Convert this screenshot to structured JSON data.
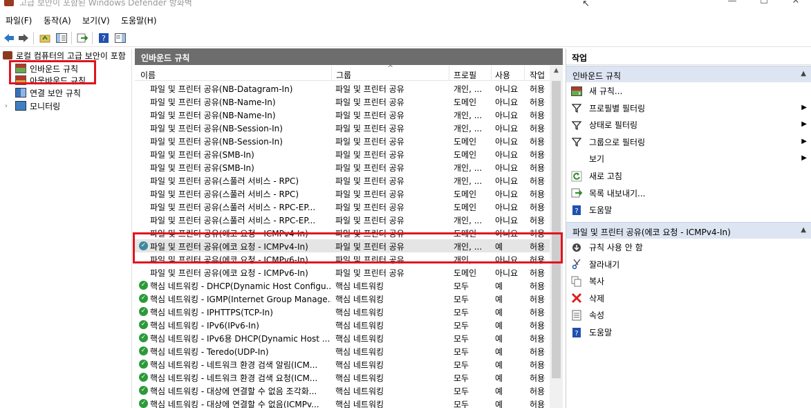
{
  "window": {
    "title": "고급 보안이 포함된 Windows Defender 방화벽",
    "min": "—",
    "max": "☐",
    "close": "✕"
  },
  "menu": [
    "파일(F)",
    "동작(A)",
    "보기(V)",
    "도움말(H)"
  ],
  "tree": {
    "root": "로컬 컴퓨터의 고급 보안이 포함",
    "items": [
      "인바운드 규칙",
      "아웃바운드 규칙",
      "연결 보안 규칙",
      "모니터링"
    ]
  },
  "center": {
    "title": "인바운드 규칙",
    "columns": [
      "이름",
      "그룹",
      "프로필",
      "사용",
      "작업"
    ],
    "rows": [
      {
        "name": "파일 및 프린터 공유(NB-Datagram-In)",
        "group": "파일 및 프린터 공유",
        "profile": "개인, ...",
        "enabled": "아니요",
        "action": "허용",
        "icon": "none"
      },
      {
        "name": "파일 및 프린터 공유(NB-Name-In)",
        "group": "파일 및 프린터 공유",
        "profile": "도메인",
        "enabled": "아니요",
        "action": "허용",
        "icon": "none"
      },
      {
        "name": "파일 및 프린터 공유(NB-Name-In)",
        "group": "파일 및 프린터 공유",
        "profile": "개인, ...",
        "enabled": "아니요",
        "action": "허용",
        "icon": "none"
      },
      {
        "name": "파일 및 프린터 공유(NB-Session-In)",
        "group": "파일 및 프린터 공유",
        "profile": "개인, ...",
        "enabled": "아니요",
        "action": "허용",
        "icon": "none"
      },
      {
        "name": "파일 및 프린터 공유(NB-Session-In)",
        "group": "파일 및 프린터 공유",
        "profile": "도메인",
        "enabled": "아니요",
        "action": "허용",
        "icon": "none"
      },
      {
        "name": "파일 및 프린터 공유(SMB-In)",
        "group": "파일 및 프린터 공유",
        "profile": "도메인",
        "enabled": "아니요",
        "action": "허용",
        "icon": "none"
      },
      {
        "name": "파일 및 프린터 공유(SMB-In)",
        "group": "파일 및 프린터 공유",
        "profile": "개인, ...",
        "enabled": "아니요",
        "action": "허용",
        "icon": "none"
      },
      {
        "name": "파일 및 프린터 공유(스풀러 서비스 - RPC)",
        "group": "파일 및 프린터 공유",
        "profile": "개인, ...",
        "enabled": "아니요",
        "action": "허용",
        "icon": "none"
      },
      {
        "name": "파일 및 프린터 공유(스풀러 서비스 - RPC)",
        "group": "파일 및 프린터 공유",
        "profile": "도메인",
        "enabled": "아니요",
        "action": "허용",
        "icon": "none"
      },
      {
        "name": "파일 및 프린터 공유(스풀러 서비스 - RPC-EP...",
        "group": "파일 및 프린터 공유",
        "profile": "도메인",
        "enabled": "아니요",
        "action": "허용",
        "icon": "none"
      },
      {
        "name": "파일 및 프린터 공유(스풀러 서비스 - RPC-EP...",
        "group": "파일 및 프린터 공유",
        "profile": "개인, ...",
        "enabled": "아니요",
        "action": "허용",
        "icon": "none"
      },
      {
        "name": "파일 및 프린터 공유(에코 요청 - ICMPv4-In)",
        "group": "파일 및 프린터 공유",
        "profile": "도메인",
        "enabled": "아니요",
        "action": "허용",
        "icon": "none"
      },
      {
        "name": "파일 및 프린터 공유(에코 요청 - ICMPv4-In)",
        "group": "파일 및 프린터 공유",
        "profile": "개인, ...",
        "enabled": "예",
        "action": "허용",
        "icon": "check-selected"
      },
      {
        "name": "파일 및 프린터 공유(에코 요청 - ICMPv6-In)",
        "group": "파일 및 프린터 공유",
        "profile": "개인, ...",
        "enabled": "아니요",
        "action": "허용",
        "icon": "none"
      },
      {
        "name": "파일 및 프린터 공유(에코 요청 - ICMPv6-In)",
        "group": "파일 및 프린터 공유",
        "profile": "도메인",
        "enabled": "아니요",
        "action": "허용",
        "icon": "none"
      },
      {
        "name": "핵심 네트워킹 - DHCP(Dynamic Host Configu...",
        "group": "핵심 네트워킹",
        "profile": "모두",
        "enabled": "예",
        "action": "허용",
        "icon": "check"
      },
      {
        "name": "핵심 네트워킹 - IGMP(Internet Group Manage...",
        "group": "핵심 네트워킹",
        "profile": "모두",
        "enabled": "예",
        "action": "허용",
        "icon": "check"
      },
      {
        "name": "핵심 네트워킹 - IPHTTPS(TCP-In)",
        "group": "핵심 네트워킹",
        "profile": "모두",
        "enabled": "예",
        "action": "허용",
        "icon": "check"
      },
      {
        "name": "핵심 네트워킹 - IPv6(IPv6-In)",
        "group": "핵심 네트워킹",
        "profile": "모두",
        "enabled": "예",
        "action": "허용",
        "icon": "check"
      },
      {
        "name": "핵심 네트워킹 - IPv6용 DHCP(Dynamic Host ...",
        "group": "핵심 네트워킹",
        "profile": "모두",
        "enabled": "예",
        "action": "허용",
        "icon": "check"
      },
      {
        "name": "핵심 네트워킹 - Teredo(UDP-In)",
        "group": "핵심 네트워킹",
        "profile": "모두",
        "enabled": "예",
        "action": "허용",
        "icon": "check"
      },
      {
        "name": "핵심 네트워킹 - 네트워크 환경 검색 알림(ICM...",
        "group": "핵심 네트워킹",
        "profile": "모두",
        "enabled": "예",
        "action": "허용",
        "icon": "check"
      },
      {
        "name": "핵심 네트워킹 - 네트워크 환경 검색 요청(ICM...",
        "group": "핵심 네트워킹",
        "profile": "모두",
        "enabled": "예",
        "action": "허용",
        "icon": "check"
      },
      {
        "name": "핵심 네트워킹 - 대상에 연결할 수 없음 조각화...",
        "group": "핵심 네트워킹",
        "profile": "모두",
        "enabled": "예",
        "action": "허용",
        "icon": "check"
      },
      {
        "name": "핵심 네트워킹 - 대상에 연결할 수 없음(ICMPv...",
        "group": "핵심 네트워킹",
        "profile": "모두",
        "enabled": "예",
        "action": "허용",
        "icon": "check"
      }
    ]
  },
  "actions": {
    "title": "작업",
    "section1": {
      "title": "인바운드 규칙",
      "items": [
        {
          "label": "새 규칙...",
          "icon": "new-rule-icon",
          "submenu": false
        },
        {
          "label": "프로필별 필터링",
          "icon": "filter-icon",
          "submenu": true
        },
        {
          "label": "상태로 필터링",
          "icon": "filter-icon",
          "submenu": true
        },
        {
          "label": "그룹으로 필터링",
          "icon": "filter-icon",
          "submenu": true
        },
        {
          "label": "보기",
          "icon": "none",
          "submenu": true
        },
        {
          "label": "새로 고침",
          "icon": "refresh-icon",
          "submenu": false
        },
        {
          "label": "목록 내보내기...",
          "icon": "export-icon",
          "submenu": false
        },
        {
          "label": "도움말",
          "icon": "help-icon",
          "submenu": false
        }
      ]
    },
    "section2": {
      "title": "파일 및 프린터 공유(에코 요청 - ICMPv4-In)",
      "items": [
        {
          "label": "규칙 사용 안 함",
          "icon": "disable-icon"
        },
        {
          "label": "잘라내기",
          "icon": "cut-icon"
        },
        {
          "label": "복사",
          "icon": "copy-icon"
        },
        {
          "label": "삭제",
          "icon": "delete-icon"
        },
        {
          "label": "속성",
          "icon": "properties-icon"
        },
        {
          "label": "도움말",
          "icon": "help-icon"
        }
      ]
    }
  },
  "colors": {
    "highlight": "#e0141e",
    "section_bg": "#dde5f2",
    "title_bg": "#6d6d6d",
    "check": "#2c9a3a"
  }
}
